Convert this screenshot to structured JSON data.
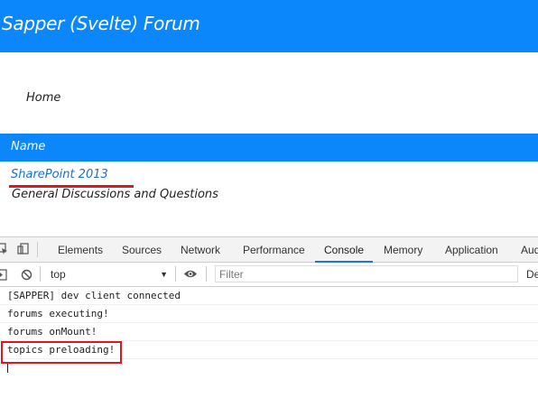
{
  "app": {
    "title": "Sapper (Svelte)  Forum",
    "home_link": "Home",
    "table_header": "Name",
    "forums": [
      {
        "name": "SharePoint 2013",
        "description": "General Discussions and Questions"
      }
    ]
  },
  "devtools": {
    "tabs": [
      {
        "label": "Elements"
      },
      {
        "label": "Sources"
      },
      {
        "label": "Network"
      },
      {
        "label": "Performance"
      },
      {
        "label": "Console",
        "active": true
      },
      {
        "label": "Memory"
      },
      {
        "label": "Application"
      },
      {
        "label": "Aud"
      }
    ],
    "toolbar": {
      "context": "top",
      "filter_placeholder": "Filter",
      "levels": "De"
    },
    "console_lines": [
      "[SAPPER] dev client connected",
      "forums executing!",
      "forums onMount!",
      "topics preloading!"
    ]
  },
  "colors": {
    "brand_blue": "#0b86fb",
    "link_blue": "#1a6fd6",
    "annotation_red": "#e0161e"
  }
}
